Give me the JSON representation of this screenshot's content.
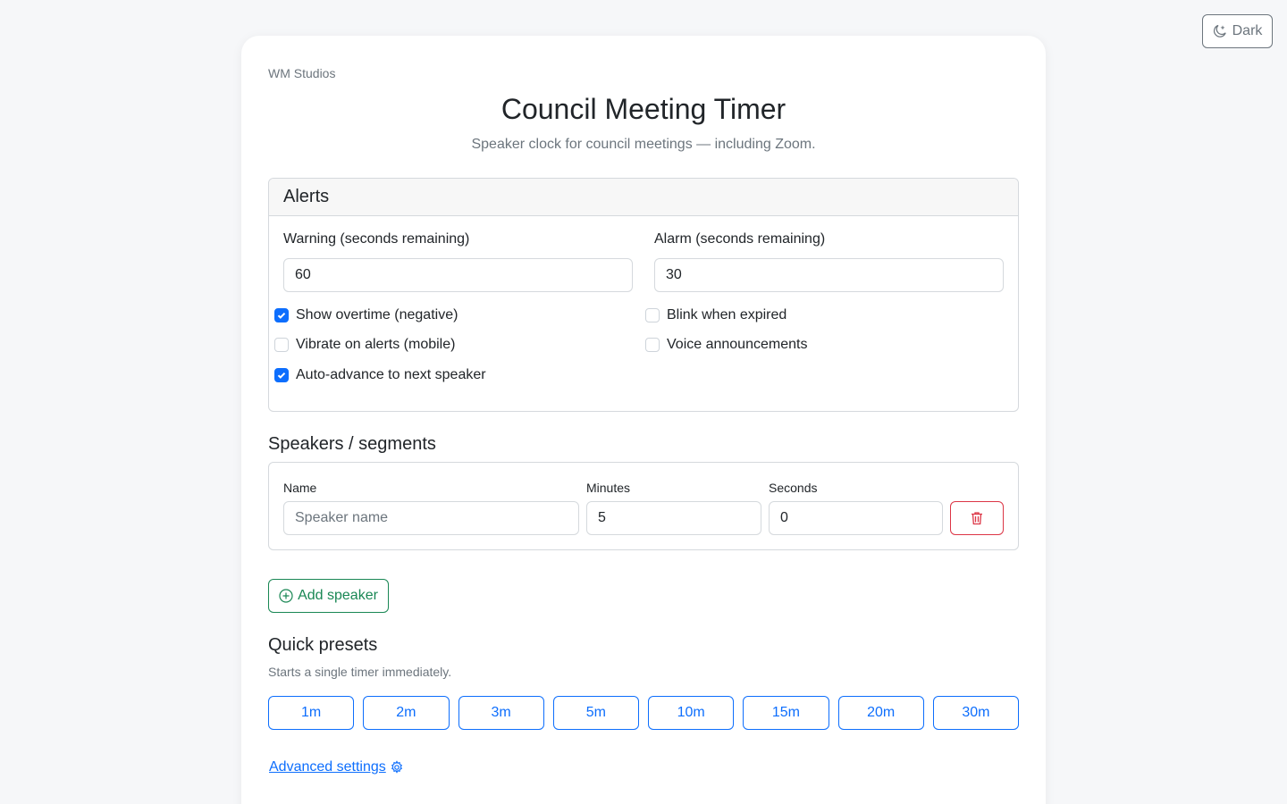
{
  "theme_toggle": {
    "label": "Dark",
    "icon": "moon-stars-icon"
  },
  "brand": "WM Studios",
  "title": "Council Meeting Timer",
  "subtitle": "Speaker clock for council meetings — including Zoom.",
  "alerts": {
    "header": "Alerts",
    "warning_label": "Warning (seconds remaining)",
    "warning_value": "60",
    "alarm_label": "Alarm (seconds remaining)",
    "alarm_value": "30",
    "options": [
      {
        "label": "Show overtime (negative)",
        "checked": true
      },
      {
        "label": "Blink when expired",
        "checked": false
      },
      {
        "label": "Vibrate on alerts (mobile)",
        "checked": false
      },
      {
        "label": "Voice announcements",
        "checked": false
      },
      {
        "label": "Auto-advance to next speaker",
        "checked": true
      }
    ]
  },
  "speakers": {
    "title": "Speakers / segments",
    "name_label": "Name",
    "name_placeholder": "Speaker name",
    "minutes_label": "Minutes",
    "minutes_value": "5",
    "seconds_label": "Seconds",
    "seconds_value": "0",
    "delete_icon": "trash-icon"
  },
  "add_speaker": {
    "label": "Add speaker",
    "icon": "plus-circle-icon"
  },
  "presets": {
    "title": "Quick presets",
    "helper": "Starts a single timer immediately.",
    "items": [
      "1m",
      "2m",
      "3m",
      "5m",
      "10m",
      "15m",
      "20m",
      "30m"
    ]
  },
  "advanced_link": {
    "label": "Advanced settings",
    "icon": "gear-icon"
  },
  "colors": {
    "primary": "#0d6efd",
    "success": "#198754",
    "danger": "#dc3545",
    "muted": "#6c757d",
    "background": "#f6f7f9"
  }
}
